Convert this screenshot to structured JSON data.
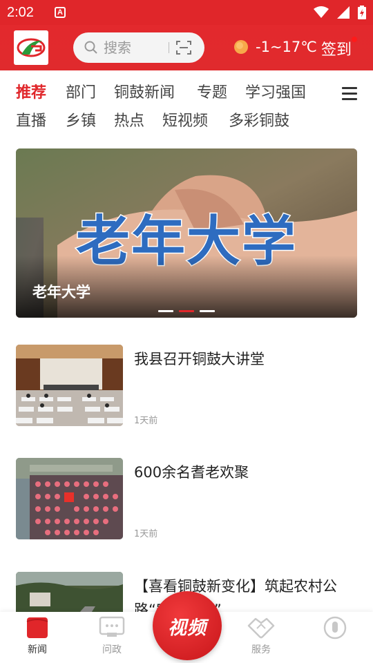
{
  "status_bar": {
    "time": "2:02",
    "notification_badge": "A"
  },
  "header": {
    "search_placeholder": "搜索",
    "weather": "-1~17℃",
    "signin_label": "签到"
  },
  "tabs": [
    {
      "label": "推荐",
      "active": true
    },
    {
      "label": "部门"
    },
    {
      "label": "铜鼓新闻"
    },
    {
      "label": "专题"
    },
    {
      "label": "学习强国"
    },
    {
      "label": "直播"
    },
    {
      "label": "乡镇"
    },
    {
      "label": "热点"
    },
    {
      "label": "短视频"
    },
    {
      "label": "多彩铜鼓"
    }
  ],
  "banner": {
    "image_text": "老年大学",
    "caption": "老年大学",
    "slide_count": 3,
    "active_slide": 2
  },
  "news": [
    {
      "title": "我县召开铜鼓大讲堂",
      "time": "1天前"
    },
    {
      "title": "600余名耆老欢聚",
      "time": "1天前"
    },
    {
      "title": "【喜看铜鼓新变化】筑起农村公路“安全屏障”",
      "time": ""
    }
  ],
  "bottom_nav": {
    "items": [
      {
        "label": "新闻",
        "active": true,
        "icon": "news-icon"
      },
      {
        "label": "问政",
        "icon": "chat-icon"
      },
      {
        "label": "服务",
        "icon": "handshake-icon"
      },
      {
        "label": "",
        "icon": "user-icon"
      }
    ],
    "center_label": "视频"
  },
  "colors": {
    "brand_red": "#e0262a",
    "text_dark": "#222222",
    "text_muted": "#999999"
  }
}
